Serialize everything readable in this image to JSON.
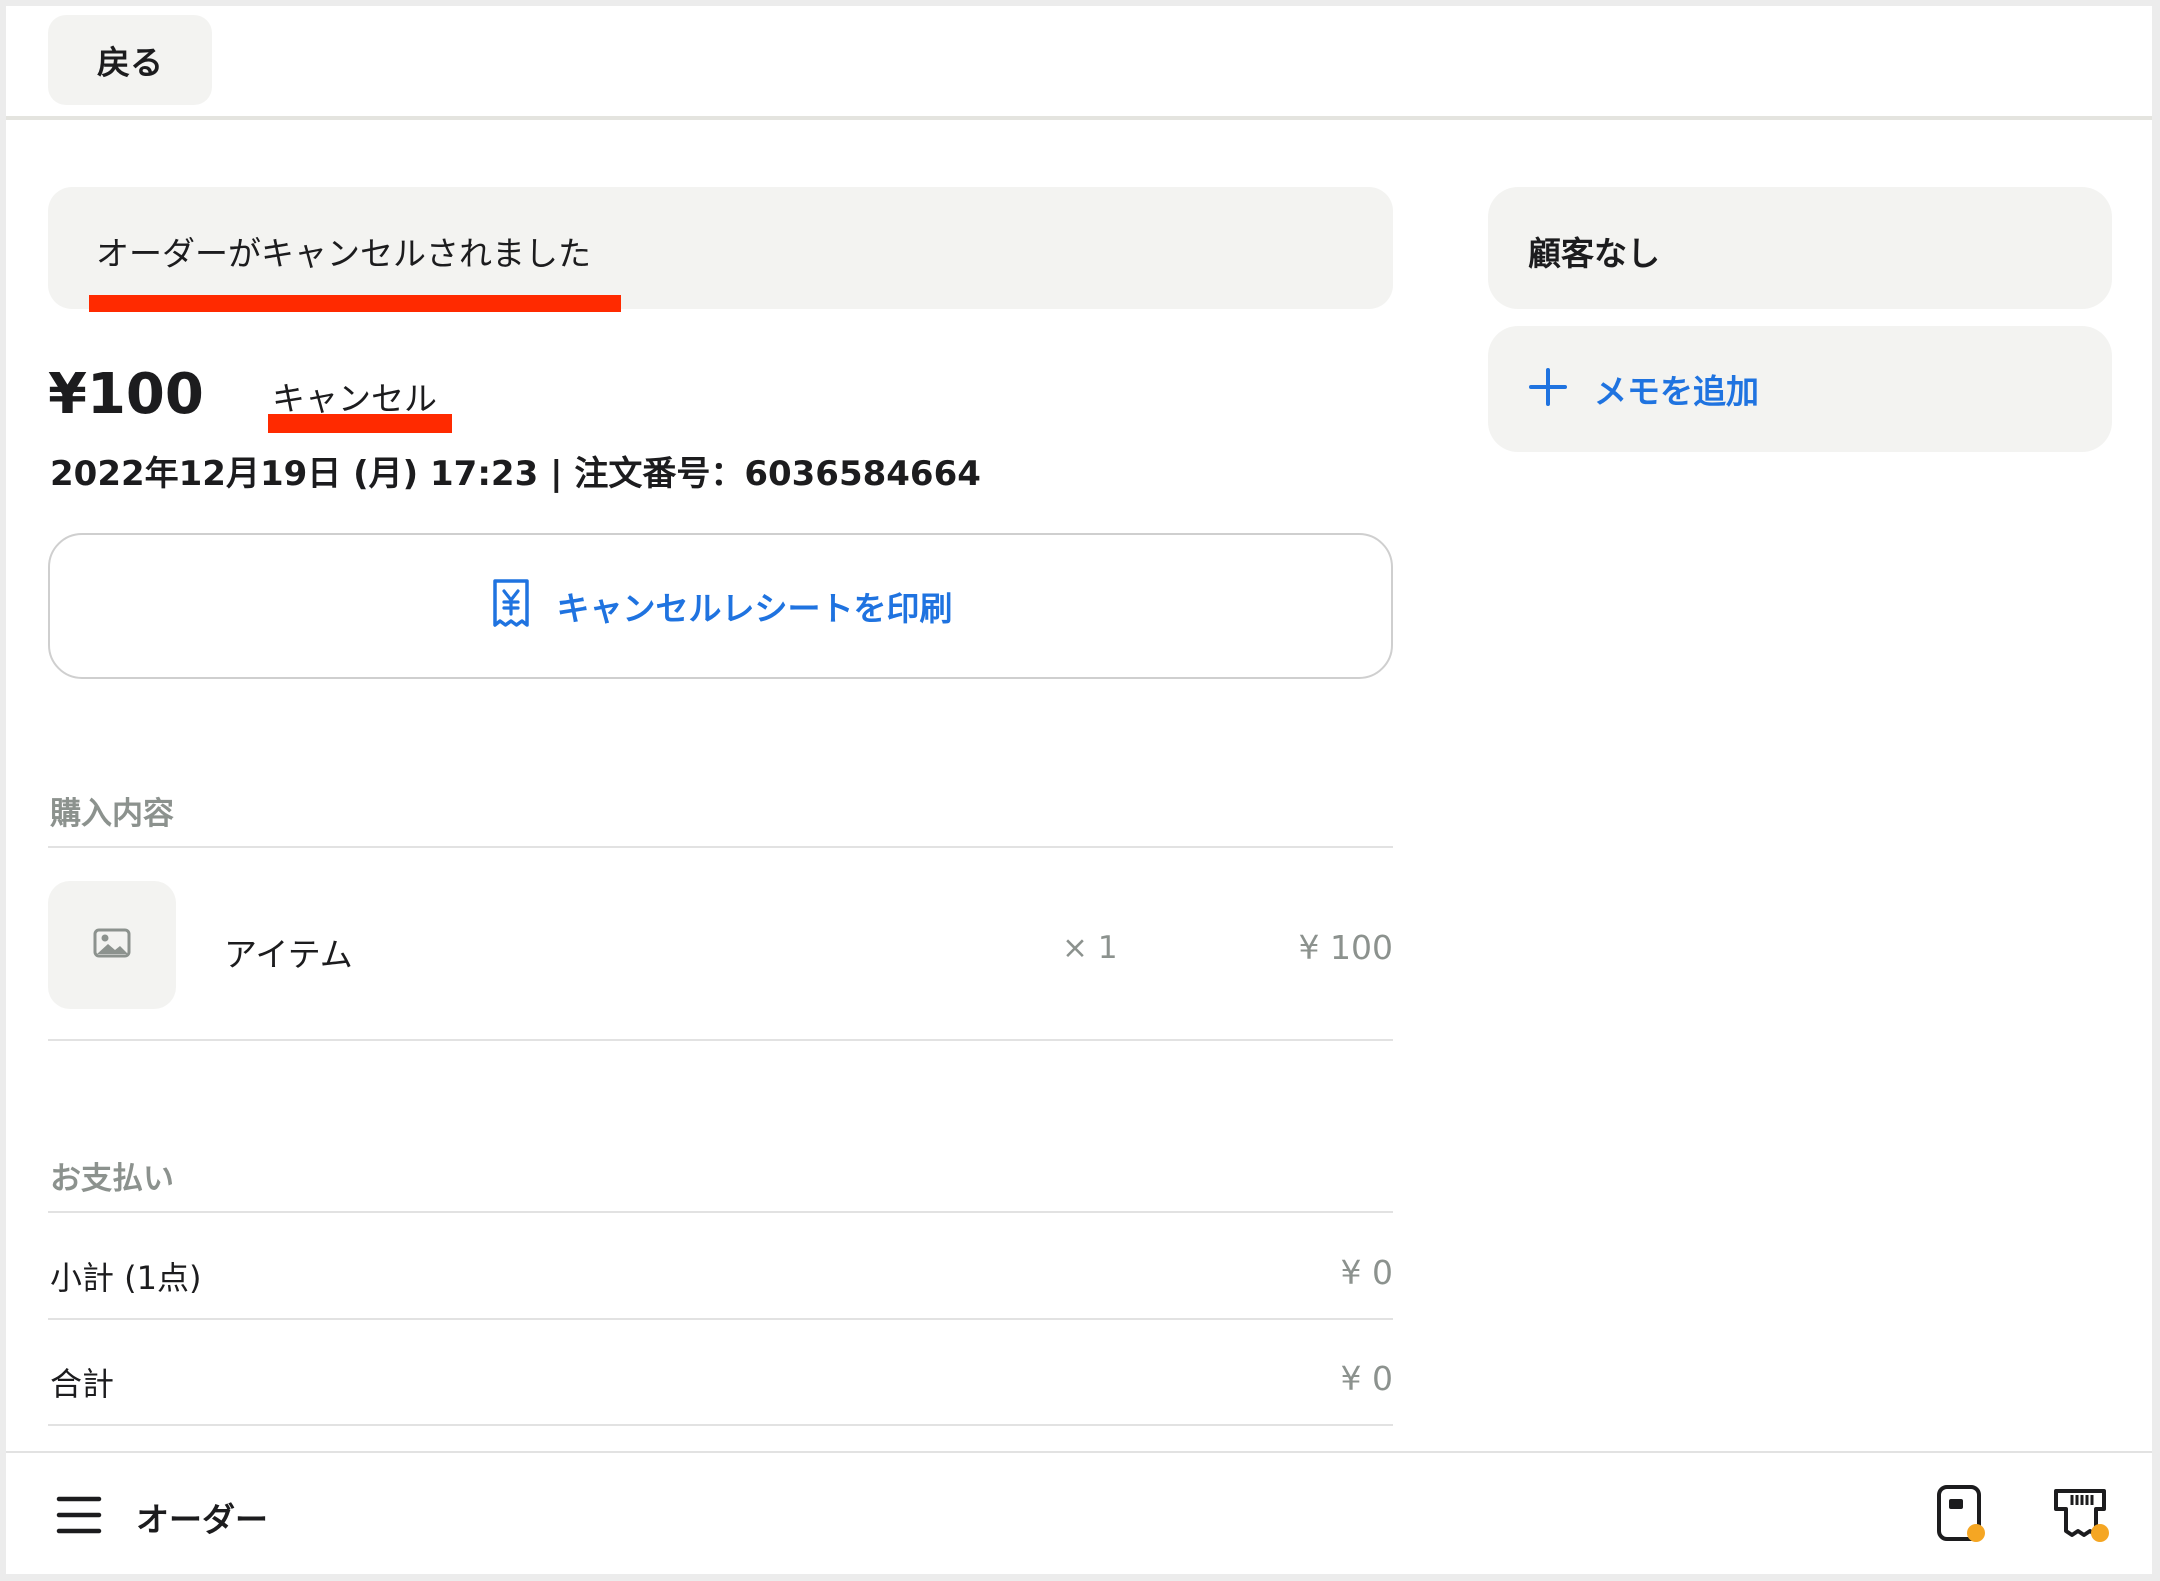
{
  "topbar": {
    "back_label": "戻る"
  },
  "banner": {
    "message": "オーダーがキャンセルされました"
  },
  "order": {
    "amount": "¥100",
    "status": "キャンセル",
    "meta": "2022年12月19日 (月) 17:23 | 注文番号：6036584664"
  },
  "print": {
    "label": "キャンセルレシートを印刷",
    "icon": "receipt-yen-icon"
  },
  "purchase": {
    "title": "購入内容",
    "items": [
      {
        "name": "アイテム",
        "qty": "× 1",
        "price": "¥ 100",
        "icon": "image-placeholder-icon"
      }
    ]
  },
  "payment": {
    "title": "お支払い",
    "rows": [
      {
        "label": "小計 (1点)",
        "value": "¥ 0"
      },
      {
        "label": "合計",
        "value": "¥ 0"
      }
    ]
  },
  "side": {
    "customer": "顧客なし",
    "memo_label": "メモを追加",
    "memo_icon": "plus-icon"
  },
  "bottombar": {
    "title": "オーダー",
    "menu_icon": "hamburger-menu-icon",
    "device_icons": [
      "card-reader-icon",
      "receipt-printer-icon"
    ],
    "status_dot_color": "#f5a623"
  },
  "colors": {
    "accent": "#1f73e0",
    "highlight": "#ff2a00",
    "muted": "#8c928e",
    "panel": "#f3f3f1"
  }
}
